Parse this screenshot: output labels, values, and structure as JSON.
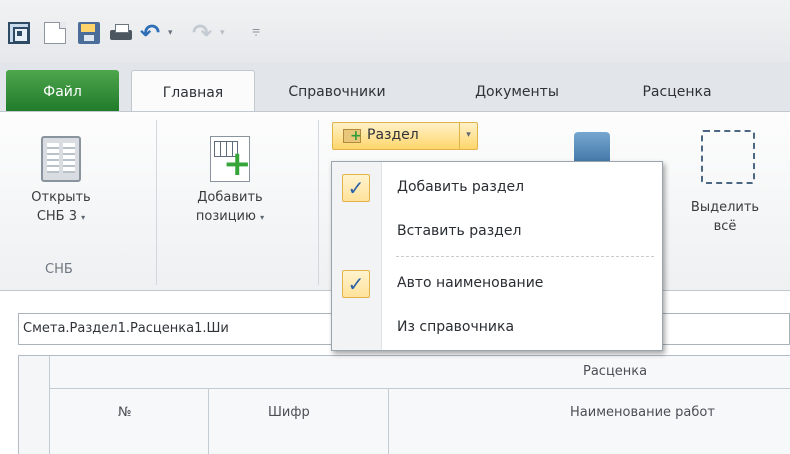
{
  "quick_access": {
    "icons": [
      "app-icon",
      "new-document-icon",
      "save-icon",
      "print-icon",
      "undo-icon",
      "redo-icon"
    ],
    "undo_glyph": "↶",
    "redo_glyph": "↷",
    "dropdown_glyph": "▾",
    "more_glyph": "⩦"
  },
  "tabs": {
    "file": "Файл",
    "home": "Главная",
    "references": "Справочники",
    "documents": "Документы",
    "rate": "Расценка"
  },
  "ribbon": {
    "open_snb_line1": "Открыть",
    "open_snb_line2": "СНБ 3",
    "snb_group_label": "СНБ",
    "add_position_line1": "Добавить",
    "add_position_line2": "позицию",
    "caret": "▾",
    "section_button": "Раздел",
    "section_arrow": "▾",
    "select_all_line1": "Выделить",
    "select_all_line2": "всё"
  },
  "path": "Смета.Раздел1.Расценка1.Ши",
  "grid": {
    "group_header": "Расценка",
    "columns": [
      "№",
      "Шифр",
      "Наименование работ"
    ]
  },
  "section_menu": {
    "items": [
      {
        "label": "Добавить раздел",
        "checked": true
      },
      {
        "label": "Вставить раздел",
        "checked": false
      },
      {
        "label": "Авто наименование",
        "checked": true
      },
      {
        "label": "Из справочника",
        "checked": false
      }
    ],
    "check_glyph": "✓"
  },
  "colors": {
    "file_tab": "#2f8f35",
    "highlight": "#ffd66b",
    "check": "#2a62a8"
  }
}
